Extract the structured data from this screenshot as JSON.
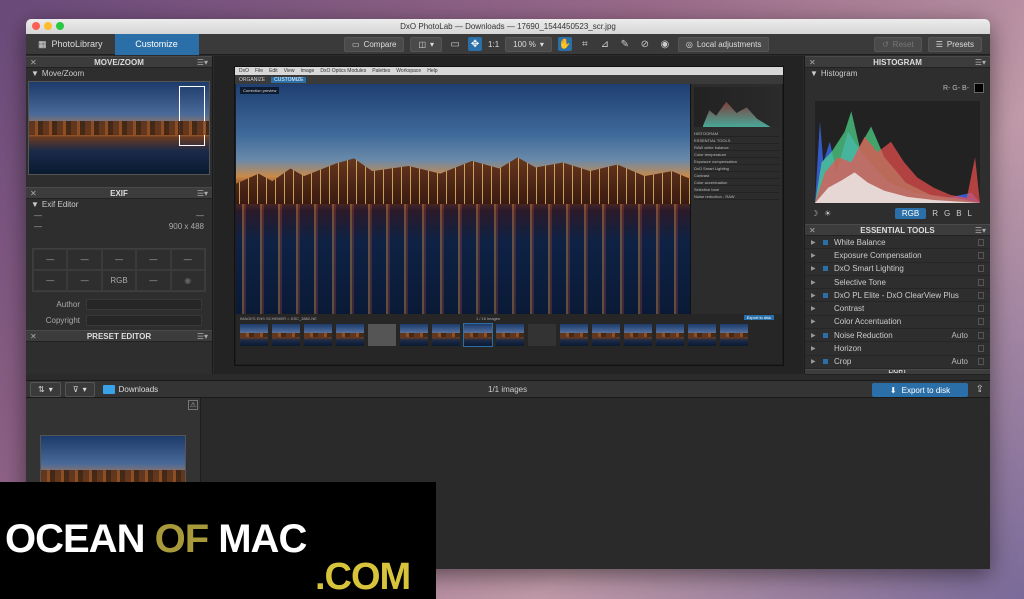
{
  "window": {
    "title": "DxO PhotoLab — Downloads — 17690_1544450523_scr.jpg",
    "traffic_colors": [
      "#fc5f57",
      "#fdbc2e",
      "#28c840"
    ]
  },
  "toolbar": {
    "tab_library": "PhotoLibrary",
    "tab_customize": "Customize",
    "compare": "Compare",
    "zoom_one": "1:1",
    "zoom_pct": "100 %",
    "local_adjustments": "Local adjustments",
    "reset": "Reset",
    "presets": "Presets"
  },
  "left_panel": {
    "move_zoom": {
      "header": "MOVE/ZOOM",
      "sub": "Move/Zoom"
    },
    "exif": {
      "header": "EXIF",
      "sub": "Exif Editor",
      "dash1": "—",
      "dash2": "—",
      "dash3": "—",
      "dimensions": "900 x 488",
      "grid": [
        "—",
        "—",
        "—",
        "—",
        "—",
        "—",
        "—",
        "RGB",
        "—",
        "◉"
      ],
      "author_label": "Author",
      "copyright_label": "Copyright"
    },
    "preset_editor": {
      "header": "PRESET EDITOR"
    }
  },
  "center": {
    "inner_menu": [
      "DxO",
      "File",
      "Edit",
      "View",
      "Image",
      "DxO Optics Modules",
      "Palettes",
      "Workspace",
      "Help"
    ],
    "inner_tabs": {
      "organize": "ORGANIZE",
      "customize": "CUSTOMIZE"
    },
    "correction_preview": "Correction preview",
    "inner_tool_rows": [
      "HISTOGRAM",
      "ESSENTIAL TOOLS",
      "RAW white balance",
      "Color temperature",
      "Exposure compensation",
      "DxO Smart Lighting",
      "Contrast",
      "Color accentuation",
      "Selective tone",
      "Noise reduction - RAW"
    ],
    "inner_strip_label": "IMAGES ENS SCHEMER > DSC_3882.NE",
    "inner_count": "1 / 16 images",
    "inner_export": "Export to disk"
  },
  "right_panel": {
    "histogram_header": "HISTOGRAM",
    "histogram_sub": "Histogram",
    "channels_label": "R- G- B-",
    "buttons": [
      "RGB",
      "R",
      "G",
      "B",
      "L"
    ],
    "essential_header": "ESSENTIAL TOOLS",
    "tools": [
      {
        "name": "White Balance",
        "checked": true,
        "auto": ""
      },
      {
        "name": "Exposure Compensation",
        "checked": false,
        "auto": ""
      },
      {
        "name": "DxO Smart Lighting",
        "checked": true,
        "auto": ""
      },
      {
        "name": "Selective Tone",
        "checked": false,
        "auto": ""
      },
      {
        "name": "DxO PL Elite - DxO ClearView Plus",
        "checked": true,
        "auto": ""
      },
      {
        "name": "Contrast",
        "checked": false,
        "auto": ""
      },
      {
        "name": "Color Accentuation",
        "checked": false,
        "auto": ""
      },
      {
        "name": "Noise Reduction",
        "checked": true,
        "auto": "Auto"
      },
      {
        "name": "Horizon",
        "checked": false,
        "auto": ""
      },
      {
        "name": "Crop",
        "checked": true,
        "auto": "Auto"
      }
    ],
    "next_header": "LIGHT"
  },
  "bottom_bar": {
    "folder": "Downloads",
    "count": "1/1 images",
    "export": "Export to disk"
  },
  "watermark": {
    "ocean": "OCEAN ",
    "of": "OF",
    "mac": " MAC",
    "com": ".COM"
  },
  "colors": {
    "accent": "#2a6fa8",
    "folder": "#3aa3e8"
  }
}
